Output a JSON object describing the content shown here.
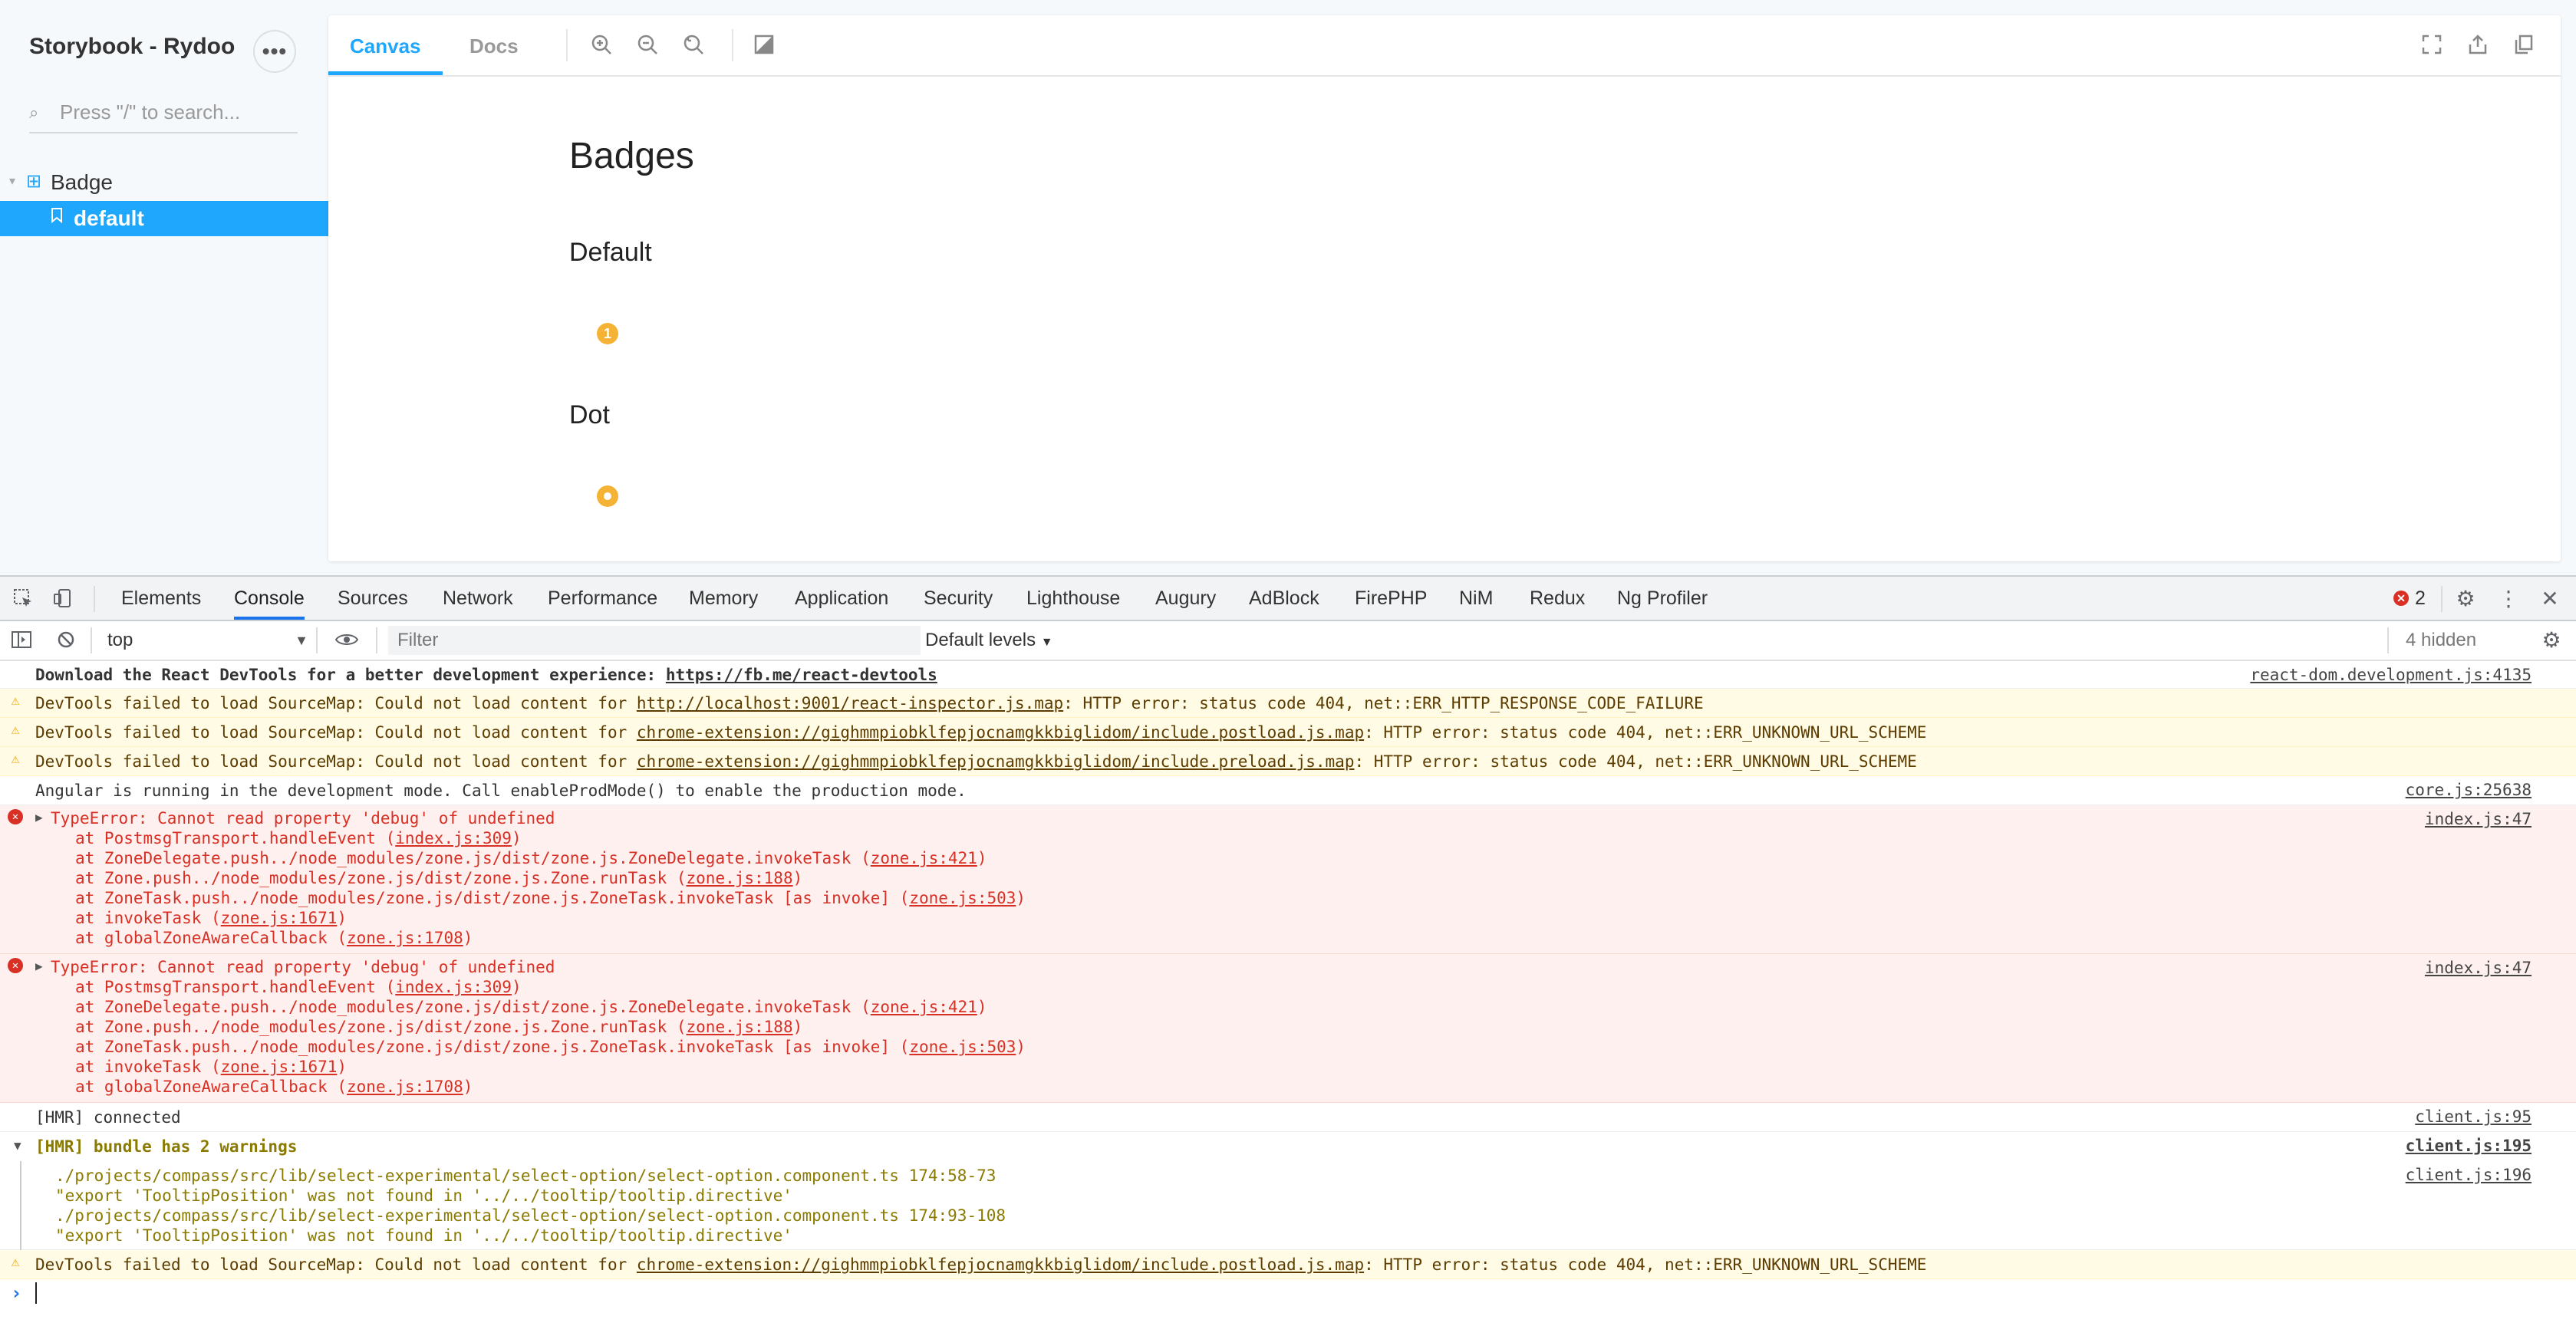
{
  "sidebar": {
    "title": "Storybook - Rydoo",
    "search_placeholder": "Press \"/\" to search...",
    "group_label": "Badge",
    "story_label": "default"
  },
  "preview": {
    "tabs": [
      "Canvas",
      "Docs"
    ],
    "title": "Badges",
    "section_default": "Default",
    "badge_value": "1",
    "section_dot": "Dot"
  },
  "devtools": {
    "tabs": [
      "Elements",
      "Console",
      "Sources",
      "Network",
      "Performance",
      "Memory",
      "Application",
      "Security",
      "Lighthouse",
      "Augury",
      "AdBlock",
      "FirePHP",
      "NiM",
      "Redux",
      "Ng Profiler"
    ],
    "error_count": "2",
    "context": "top",
    "filter_placeholder": "Filter",
    "levels": "Default levels",
    "hidden": "4 hidden"
  },
  "console": {
    "r1_text": "Download the React DevTools for a better development experience: ",
    "r1_link": "https://fb.me/react-devtools",
    "r1_src": "react-dom.development.js:4135",
    "w_prefix": "DevTools failed to load SourceMap: Could not load content for ",
    "w1_link": "http://localhost:9001/react-inspector.js.map",
    "w1_suffix": ": HTTP error: status code 404, net::ERR_HTTP_RESPONSE_CODE_FAILURE",
    "w2_link": "chrome-extension://gighmmpiobklfepjocnamgkkbiglidom/include.postload.js.map",
    "w2_suffix": ": HTTP error: status code 404, net::ERR_UNKNOWN_URL_SCHEME",
    "w3_link": "chrome-extension://gighmmpiobklfepjocnamgkkbiglidom/include.preload.js.map",
    "w3_suffix": ": HTTP error: status code 404, net::ERR_UNKNOWN_URL_SCHEME",
    "r5_text": "Angular is running in the development mode. Call enableProdMode() to enable the production mode.",
    "r5_src": "core.js:25638",
    "e_title": "TypeError: Cannot read property 'debug' of undefined",
    "e_src": "index.js:47",
    "e_l1a": "at PostmsgTransport.handleEvent (",
    "e_l1b": "index.js:309",
    "e_l1c": ")",
    "e_l2a": "at ZoneDelegate.push../node_modules/zone.js/dist/zone.js.ZoneDelegate.invokeTask (",
    "e_l2b": "zone.js:421",
    "e_l2c": ")",
    "e_l3a": "at Zone.push../node_modules/zone.js/dist/zone.js.Zone.runTask (",
    "e_l3b": "zone.js:188",
    "e_l3c": ")",
    "e_l4a": "at ZoneTask.push../node_modules/zone.js/dist/zone.js.ZoneTask.invokeTask [as invoke] (",
    "e_l4b": "zone.js:503",
    "e_l4c": ")",
    "e_l5a": "at invokeTask (",
    "e_l5b": "zone.js:1671",
    "e_l5c": ")",
    "e_l6a": "at globalZoneAwareCallback (",
    "e_l6b": "zone.js:1708",
    "e_l6c": ")",
    "hmr1_text": "[HMR] connected",
    "hmr1_src": "client.js:95",
    "hmr2_text": "[HMR] bundle has 2 warnings",
    "hmr2_src": "client.js:195",
    "hmr3_l1": "./projects/compass/src/lib/select-experimental/select-option/select-option.component.ts 174:58-73",
    "hmr3_l2": "\"export 'TooltipPosition' was not found in '../../tooltip/tooltip.directive'",
    "hmr3_l3": "./projects/compass/src/lib/select-experimental/select-option/select-option.component.ts 174:93-108",
    "hmr3_l4": "\"export 'TooltipPosition' was not found in '../../tooltip/tooltip.directive'",
    "hmr3_src": "client.js:196"
  },
  "colors": {
    "accent": "#1ea7fd",
    "badge": "#f5b335",
    "error": "#d93025",
    "warn": "#f0a30a"
  }
}
